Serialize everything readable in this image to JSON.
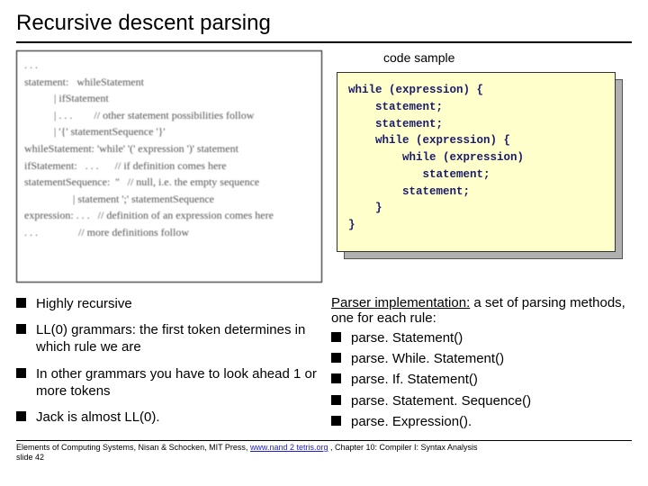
{
  "title": "Recursive descent parsing",
  "grammar": {
    "lines": [
      ". . .",
      "statement:   whileStatement",
      "           | ifStatement",
      "           | . . .        // other statement possibilities follow",
      "           | '{' statementSequence '}'",
      "",
      "whileStatement: 'while' '(' expression ')' statement",
      "",
      "ifStatement:   . . .      // if definition comes here",
      "",
      "statementSequence:  ''   // null, i.e. the empty sequence",
      "                  | statement ';' statementSequence",
      "",
      "expression: . . .   // definition of an expression comes here",
      ". . .               // more definitions follow"
    ]
  },
  "code_sample": {
    "label": "code sample",
    "text": "while (expression) {\n    statement;\n    statement;\n    while (expression) {\n        while (expression)\n           statement;\n        statement;\n    }\n}"
  },
  "left_bullets": [
    "Highly recursive",
    "LL(0) grammars: the first token determines in which rule we are",
    "In other grammars you have to look ahead 1 or more tokens",
    "Jack is almost LL(0)."
  ],
  "right": {
    "intro_underlined": "Parser implementation:",
    "intro_rest": " a set of parsing methods, one for each rule:",
    "bullets": [
      "parse. Statement()",
      "parse. While. Statement()",
      "parse. If. Statement()",
      "parse. Statement. Sequence()",
      "parse. Expression()."
    ]
  },
  "footer": {
    "text_before": "Elements of Computing Systems, Nisan & Schocken, MIT Press, ",
    "link": "www.nand 2 tetris.org",
    "text_after": " , Chapter 10: Compiler I: Syntax Analysis",
    "slide_no": "slide 42"
  }
}
